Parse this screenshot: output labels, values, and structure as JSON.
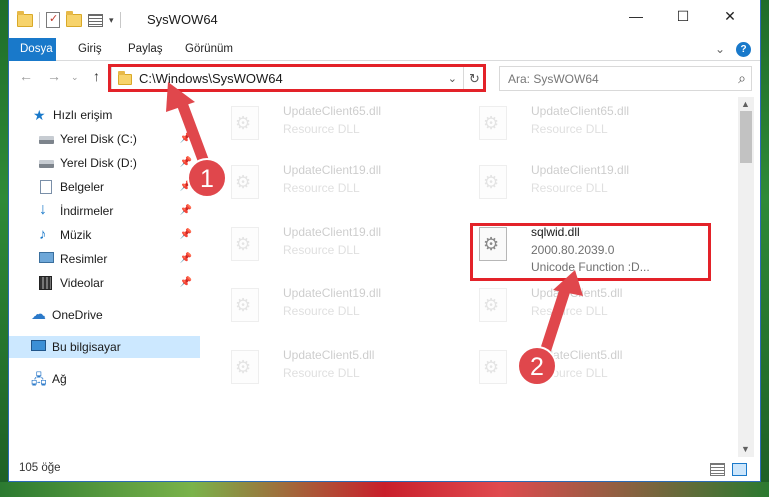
{
  "window": {
    "title": "SysWOW64",
    "controls": {
      "minimize": "—",
      "maximize": "☐",
      "close": "✕"
    }
  },
  "ribbon": {
    "tabs": [
      {
        "label": "Dosya",
        "active": true
      },
      {
        "label": "Giriş",
        "active": false
      },
      {
        "label": "Paylaş",
        "active": false
      },
      {
        "label": "Görünüm",
        "active": false
      }
    ],
    "expand_icon": "chevron-down-icon",
    "help_label": "?"
  },
  "navigation": {
    "back_icon": "arrow-left-icon",
    "forward_icon": "arrow-right-icon",
    "recent_icon": "chevron-down-icon",
    "up_icon": "arrow-up-icon",
    "address": "C:\\Windows\\SysWOW64",
    "search_placeholder": "Ara: SysWOW64"
  },
  "sidebar": {
    "items": [
      {
        "label": "Hızlı erişim",
        "icon": "star-icon",
        "pinned": false
      },
      {
        "label": "Yerel Disk (C:)",
        "icon": "disk-icon",
        "pinned": true
      },
      {
        "label": "Yerel Disk (D:)",
        "icon": "disk-icon",
        "pinned": true
      },
      {
        "label": "Belgeler",
        "icon": "document-icon",
        "pinned": true
      },
      {
        "label": "İndirmeler",
        "icon": "download-icon",
        "pinned": true
      },
      {
        "label": "Müzik",
        "icon": "music-icon",
        "pinned": true
      },
      {
        "label": "Resimler",
        "icon": "picture-icon",
        "pinned": true
      },
      {
        "label": "Videolar",
        "icon": "video-icon",
        "pinned": true
      },
      {
        "label": "OneDrive",
        "icon": "cloud-icon",
        "pinned": false
      },
      {
        "label": "Bu bilgisayar",
        "icon": "computer-icon",
        "selected": true
      },
      {
        "label": "Ağ",
        "icon": "network-icon",
        "pinned": false
      }
    ]
  },
  "files": [
    {
      "name": "UpdateClient65.dll",
      "type": "Resource DLL",
      "faded": true
    },
    {
      "name": "UpdateClient65.dll",
      "type": "Resource DLL",
      "faded": true
    },
    {
      "name": "UpdateClient19.dll",
      "type": "Resource DLL",
      "faded": true
    },
    {
      "name": "UpdateClient19.dll",
      "type": "Resource DLL",
      "faded": true
    },
    {
      "name": "UpdateClient19.dll",
      "type": "Resource DLL",
      "faded": true
    },
    {
      "name": "sqlwid.dll",
      "version": "2000.80.2039.0",
      "description": "Unicode Function :D...",
      "faded": false
    },
    {
      "name": "UpdateClient19.dll",
      "type": "Resource DLL",
      "faded": true
    },
    {
      "name": "UpdateClient5.dll",
      "type": "Resource DLL",
      "faded": true
    },
    {
      "name": "UpdateClient5.dll",
      "type": "Resource DLL",
      "faded": true
    },
    {
      "name": "UpdateClient5.dll",
      "type": "Resource DLL",
      "faded": true
    }
  ],
  "status": {
    "item_count": "105 öğe"
  },
  "annotations": {
    "step1": "1",
    "step2": "2",
    "highlight_color": "#e32229",
    "arrow_color": "#e0474c"
  }
}
